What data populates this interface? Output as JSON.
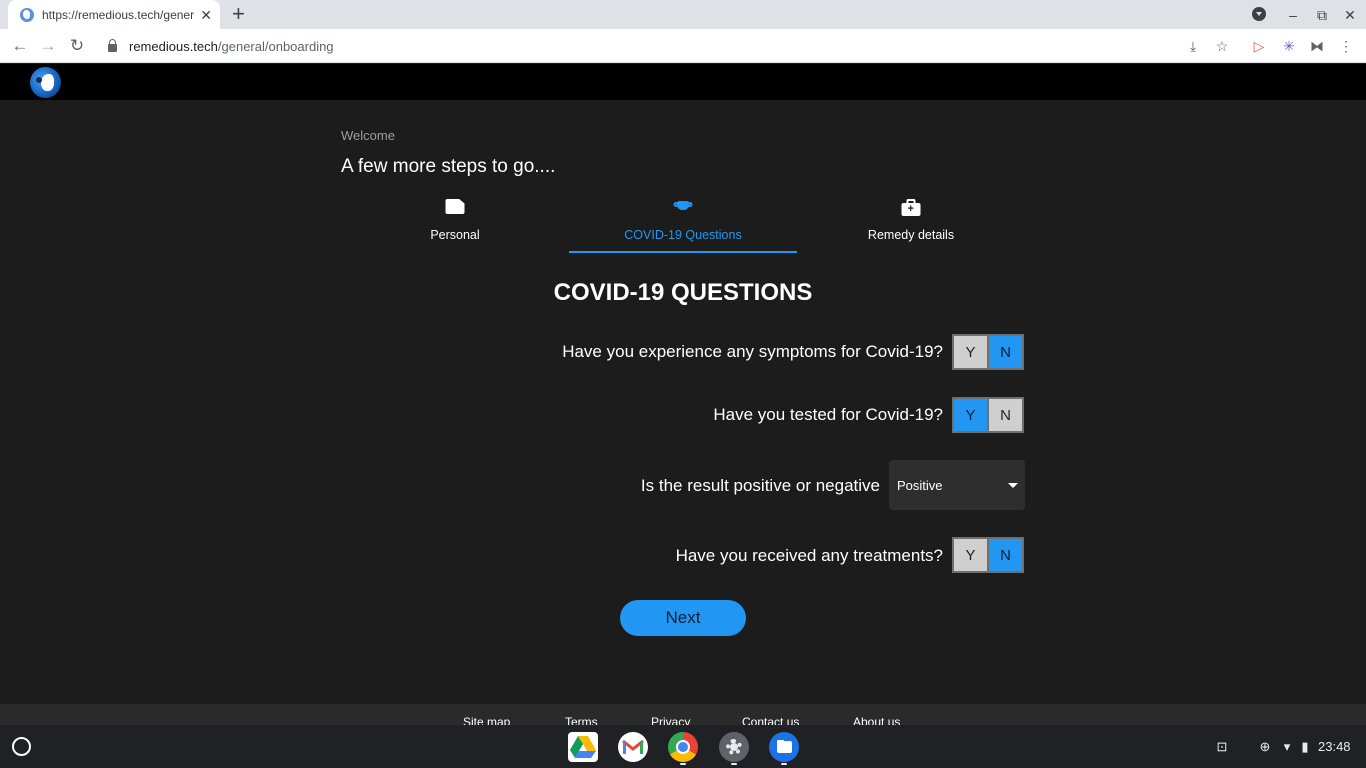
{
  "browser": {
    "tab_title": "https://remedious.tech/general/onboarding",
    "tab_close": "✕",
    "new_tab": "+",
    "url_host": "remedious.tech",
    "url_path": "/general/onboarding",
    "back": "←",
    "forward": "→",
    "reload": "↻",
    "minimize": "–",
    "restore": "⧉",
    "close": "✕",
    "install": "⤓",
    "bookmark": "☆",
    "cast": "▷",
    "extension": "✳",
    "puzzle": "⧓",
    "menu": "⋮"
  },
  "page": {
    "welcome": "Welcome",
    "title": "A few more steps to go....",
    "tabs": [
      {
        "label": "Personal",
        "icon": "card-icon",
        "active": false
      },
      {
        "label": "COVID-19 Questions",
        "icon": "mask-icon",
        "active": true
      },
      {
        "label": "Remedy details",
        "icon": "medical-kit-icon",
        "active": false
      }
    ],
    "kit_plus": "+",
    "section_title": "COVID-19 QUESTIONS",
    "questions": [
      {
        "label": "Have you experience any symptoms for Covid-19?",
        "yes": "Y",
        "no": "N",
        "selected": "N"
      },
      {
        "label": "Have you tested for Covid-19?",
        "yes": "Y",
        "no": "N",
        "selected": "Y"
      },
      {
        "label": "Have you received any treatments?",
        "yes": "Y",
        "no": "N",
        "selected": "N"
      }
    ],
    "result_question": {
      "label": "Is the result positive or negative",
      "value": "Positive"
    },
    "next_label": "Next"
  },
  "footer": {
    "links": [
      "Site map",
      "Terms",
      "Privacy",
      "Contact us",
      "About us"
    ]
  },
  "shelf": {
    "apps": [
      "google-drive-icon",
      "gmail-icon",
      "chrome-icon",
      "settings-icon",
      "files-icon"
    ],
    "tray_screenshot": "⊡",
    "tray_add": "⊕",
    "tray_wifi": "▾",
    "tray_battery": "▮",
    "clock": "23:48"
  },
  "colors": {
    "accent": "#2196f3",
    "background": "#1c1c1c",
    "header": "#000000"
  }
}
